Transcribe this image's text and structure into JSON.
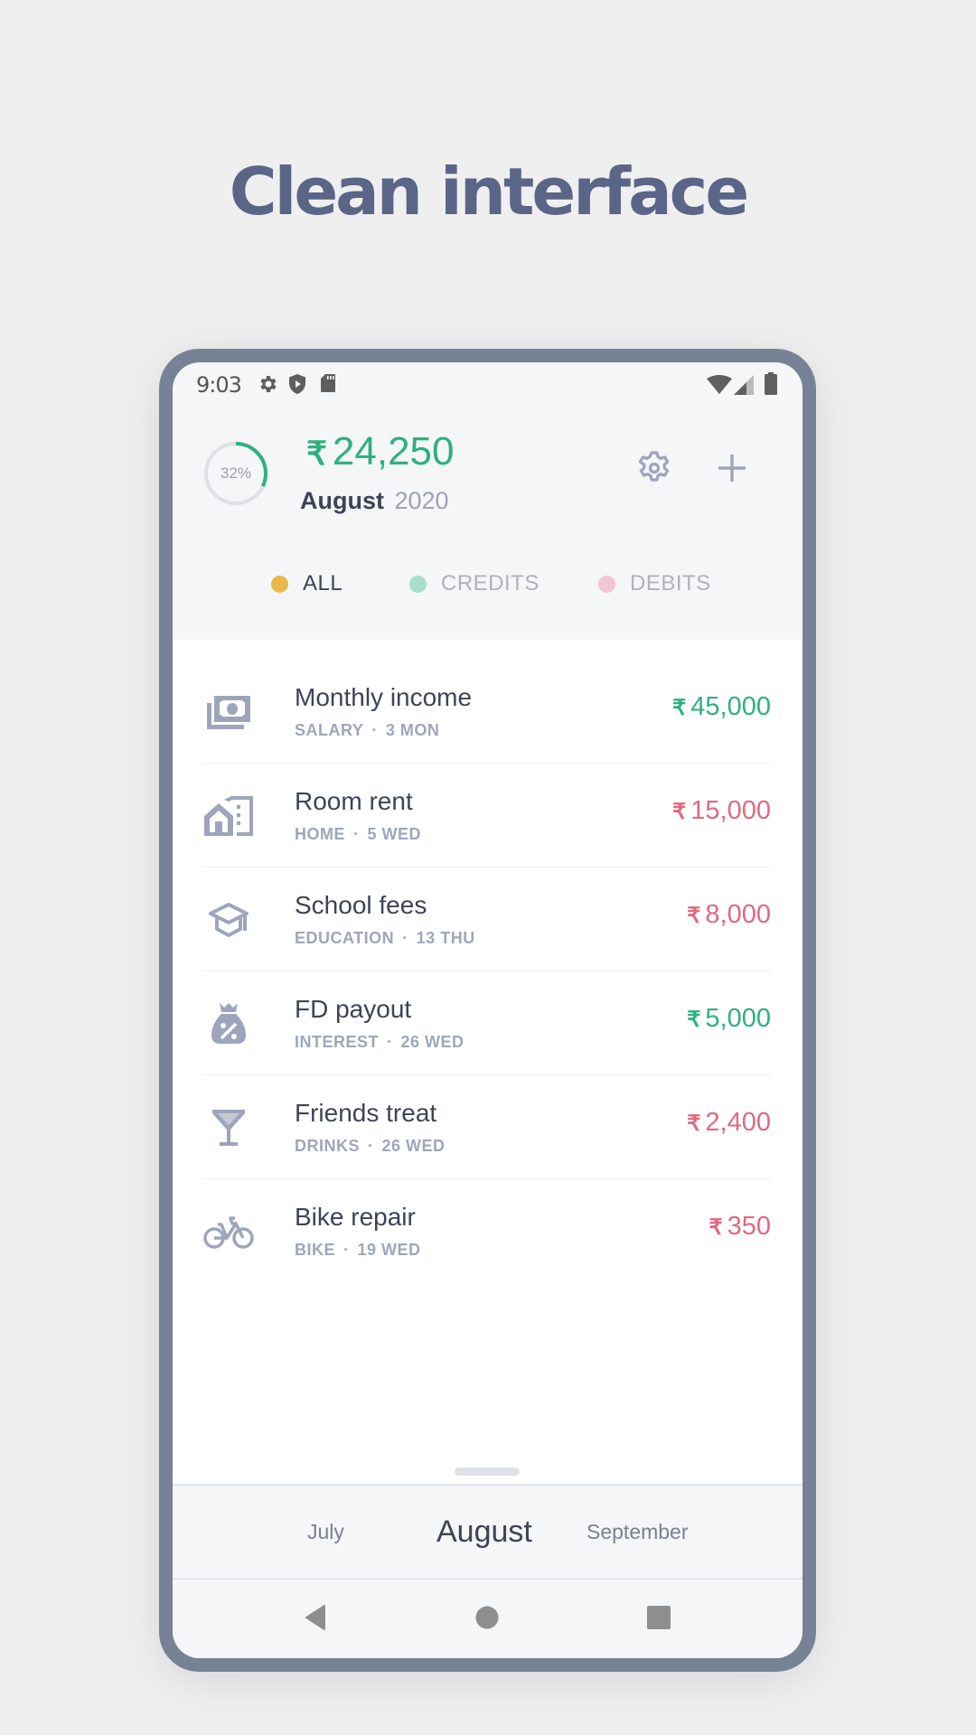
{
  "headline": "Clean interface",
  "status_bar": {
    "time": "9:03",
    "left_icons": [
      "settings-gear-icon",
      "shield-play-icon",
      "sd-card-icon"
    ],
    "right_icons": [
      "wifi-icon",
      "cell-signal-icon",
      "battery-icon"
    ]
  },
  "header": {
    "progress_percent": 32,
    "progress_label": "32%",
    "currency_symbol": "₹",
    "balance": "24,250",
    "month": "August",
    "year": "2020",
    "settings_icon": "gear-icon",
    "add_icon": "plus-icon"
  },
  "filters": [
    {
      "label": "ALL",
      "color": "#e8b94a",
      "active": true
    },
    {
      "label": "CREDITS",
      "color": "#a6e0cb",
      "active": false
    },
    {
      "label": "DEBITS",
      "color": "#f2c6cf",
      "active": false
    }
  ],
  "colors": {
    "credit": "#2fb07f",
    "debit": "#e0697e",
    "icon": "#9ea5bb",
    "frame": "#788296"
  },
  "transactions": [
    {
      "title": "Monthly income",
      "category": "SALARY",
      "date": "3 MON",
      "amount": "45,000",
      "type": "credit",
      "icon": "money-icon"
    },
    {
      "title": "Room rent",
      "category": "HOME",
      "date": "5 WED",
      "amount": "15,000",
      "type": "debit",
      "icon": "home-building-icon"
    },
    {
      "title": "School fees",
      "category": "EDUCATION",
      "date": "13 THU",
      "amount": "8,000",
      "type": "debit",
      "icon": "graduation-cap-icon"
    },
    {
      "title": "FD payout",
      "category": "INTEREST",
      "date": "26 WED",
      "amount": "5,000",
      "type": "credit",
      "icon": "money-bag-percent-icon"
    },
    {
      "title": "Friends treat",
      "category": "DRINKS",
      "date": "26 WED",
      "amount": "2,400",
      "type": "debit",
      "icon": "cocktail-glass-icon"
    },
    {
      "title": "Bike repair",
      "category": "BIKE",
      "date": "19 WED",
      "amount": "350",
      "type": "debit",
      "icon": "bicycle-icon"
    }
  ],
  "month_selector": {
    "previous": "July",
    "current": "August",
    "next": "September"
  },
  "nav_bar": [
    "back-icon",
    "home-icon",
    "recents-icon"
  ]
}
